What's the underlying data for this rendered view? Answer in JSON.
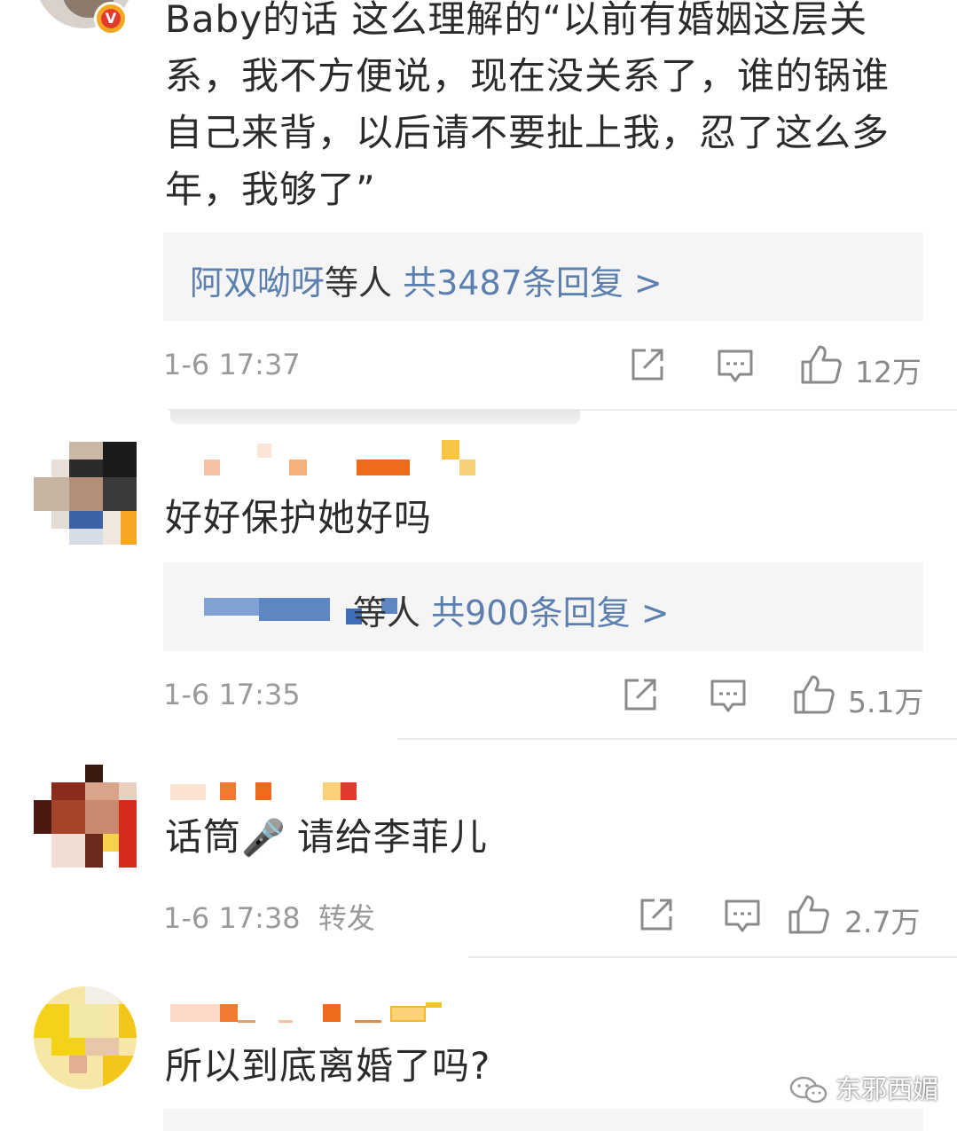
{
  "comments": [
    {
      "text": "Baby的话 这么理解的“以前有婚姻这层关系，我不方便说，现在没关系了，谁的锅谁自己来背，以后请不要扯上我，忍了这么多年，我够了”",
      "reply_names": "阿双呦呀",
      "reply_mid": "等人",
      "reply_count": "共3487条回复 >",
      "time": "1-6 17:37",
      "likes": "12万"
    },
    {
      "text": "好好保护她好吗",
      "reply_mid": "等人",
      "reply_count": "共900条回复 >",
      "time": "1-6 17:35",
      "likes": "5.1万"
    },
    {
      "text_before": "话筒",
      "emoji": "🎤",
      "text_after": "请给李菲儿",
      "time": "1-6 17:38",
      "extra": "转发",
      "likes": "2.7万"
    },
    {
      "text": "所以到底离婚了吗?"
    }
  ],
  "watermark": {
    "label": "东邪西媚"
  },
  "icons": {
    "verified_badge": "verified-v-badge-icon",
    "share": "share-icon",
    "comment": "comment-icon",
    "like": "thumbs-up-icon",
    "watermark_logo": "wechat-icon"
  },
  "colors": {
    "link_blue": "#5b7fae",
    "meta_gray": "#9a9a9a",
    "reply_bg": "#f5f5f5",
    "badge_orange": "#f5a623",
    "badge_red": "#e23b2e"
  }
}
